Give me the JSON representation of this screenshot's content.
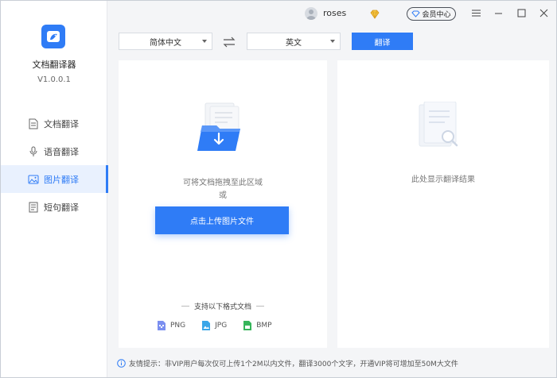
{
  "app": {
    "name": "文档翻译器",
    "version": "V1.0.0.1"
  },
  "sidebar": {
    "items": [
      {
        "label": "文档翻译",
        "icon": "document-icon",
        "active": false
      },
      {
        "label": "语音翻译",
        "icon": "microphone-icon",
        "active": false
      },
      {
        "label": "图片翻译",
        "icon": "image-icon",
        "active": true
      },
      {
        "label": "短句翻译",
        "icon": "phrase-icon",
        "active": false
      }
    ]
  },
  "titlebar": {
    "username": "roses",
    "vip_label": "会员中心"
  },
  "toolbar": {
    "source_lang": "简体中文",
    "target_lang": "英文",
    "translate_label": "翻译"
  },
  "upload": {
    "drop_hint": "可将文档拖拽至此区域",
    "or_text": "或",
    "button_label": "点击上传图片文件",
    "formats_title": "支持以下格式文档",
    "formats": [
      "PNG",
      "JPG",
      "BMP"
    ]
  },
  "result": {
    "placeholder": "此处显示翻译结果"
  },
  "footer": {
    "tip": "友情提示：非VIP用户每次仅可上传1个2M以内文件，翻译3000个文字，开通VIP将可增加至50M大文件"
  },
  "colors": {
    "accent": "#2f7cf6",
    "active_bg": "#e9f1fe",
    "vip_gold": "#e8b53a"
  }
}
